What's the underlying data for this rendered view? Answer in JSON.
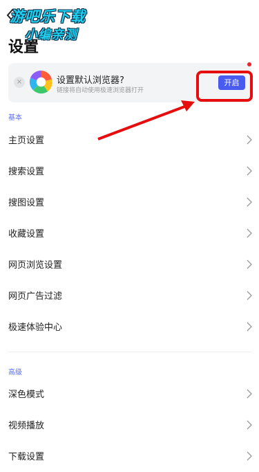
{
  "header": {
    "title": "设置"
  },
  "watermark": {
    "line1": "游吧乐下载",
    "line2": "小编亲测"
  },
  "banner": {
    "title": "设置默认浏览器?",
    "subtitle": "链接将自动使用极速浏览器打开",
    "button_label": "开启",
    "close_glyph": "×"
  },
  "sections": {
    "basic": {
      "label": "基本",
      "items": [
        "主页设置",
        "搜索设置",
        "搜图设置",
        "收藏设置",
        "网页浏览设置",
        "网页广告过滤",
        "极速体验中心"
      ]
    },
    "advanced": {
      "label": "高级",
      "items": [
        "深色模式",
        "视频播放",
        "下载设置"
      ]
    }
  },
  "colors": {
    "accent": "#4a5cf0",
    "annotation": "#e50d0d",
    "section_label": "#5b6ef5"
  }
}
